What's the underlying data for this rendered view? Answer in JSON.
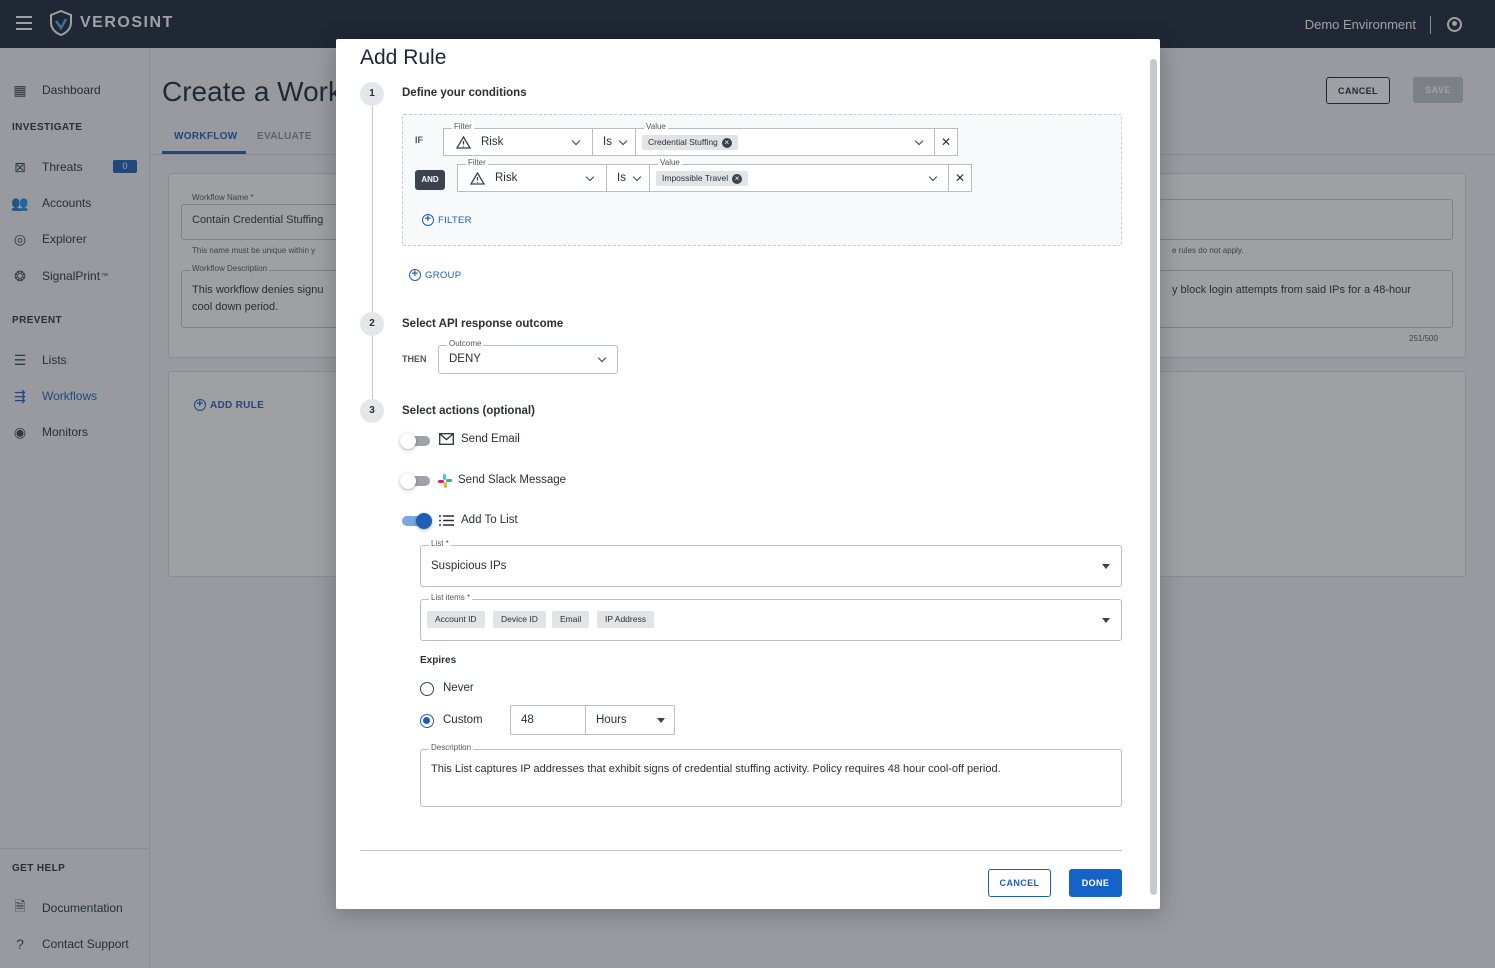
{
  "app": {
    "brand": "VEROSINT",
    "environment": "Demo Environment"
  },
  "sidebar": {
    "dashboard": "Dashboard",
    "investigate_header": "INVESTIGATE",
    "threats": "Threats",
    "threats_count": "0",
    "accounts": "Accounts",
    "explorer": "Explorer",
    "signalprint": "SignalPrint",
    "signalprint_tm": "™",
    "prevent_header": "PREVENT",
    "lists": "Lists",
    "workflows": "Workflows",
    "monitors": "Monitors",
    "help_header": "GET HELP",
    "documentation": "Documentation",
    "contact_support": "Contact Support"
  },
  "page": {
    "title": "Create a Workflow",
    "tabs": [
      "WORKFLOW",
      "EVALUATE"
    ],
    "cancel": "CANCEL",
    "save": "SAVE",
    "workflow_name_label": "Workflow Name *",
    "workflow_name_value": "Contain Credential Stuffing",
    "workflow_name_hint": "This name must be unique within y",
    "default_hint": "e rules do not apply.",
    "desc_label": "Workflow Description",
    "desc_left": "This workflow denies signu cool down period.",
    "desc_right": "y block login attempts from said IPs for a 48-hour",
    "desc_count": "251/500",
    "add_rule": "ADD RULE"
  },
  "modal": {
    "title": "Add Rule",
    "step1": {
      "num": "1",
      "title": "Define your conditions"
    },
    "conditions": [
      {
        "connector": "IF",
        "filter_label": "Filter",
        "filter": "Risk",
        "operator": "Is",
        "value_label": "Value",
        "value_chip": "Credential Stuffing"
      },
      {
        "connector": "AND",
        "filter_label": "Filter",
        "filter": "Risk",
        "operator": "Is",
        "value_label": "Value",
        "value_chip": "Impossible Travel"
      }
    ],
    "add_filter": "FILTER",
    "add_group": "GROUP",
    "step2": {
      "num": "2",
      "title": "Select API response outcome"
    },
    "then_label": "THEN",
    "outcome_label": "Outcome",
    "outcome_value": "DENY",
    "step3": {
      "num": "3",
      "title": "Select actions (optional)"
    },
    "actions": [
      {
        "label": "Send Email",
        "enabled": false
      },
      {
        "label": "Send Slack Message",
        "enabled": false
      },
      {
        "label": "Add To List",
        "enabled": true
      }
    ],
    "list_label": "List *",
    "list_value": "Suspicious IPs",
    "list_items_label": "List items *",
    "list_items": [
      "Account ID",
      "Device ID",
      "Email",
      "IP Address"
    ],
    "expires_label": "Expires",
    "expires_never": "Never",
    "expires_custom": "Custom",
    "expires_amount": "48",
    "expires_unit": "Hours",
    "description_label": "Description",
    "description_value": "This List captures IP addresses that exhibit signs of credential stuffing activity. Policy requires 48 hour cool-off period.",
    "cancel": "CANCEL",
    "done": "DONE"
  }
}
